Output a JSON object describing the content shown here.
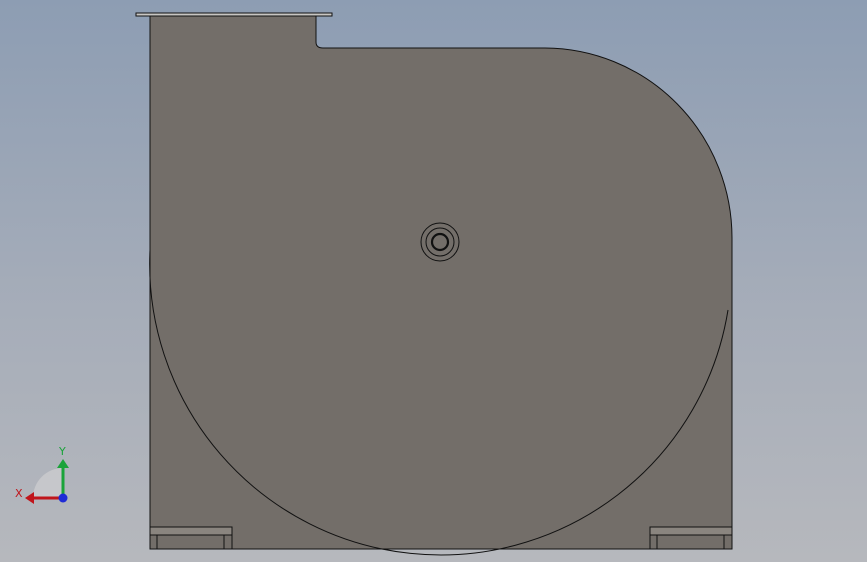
{
  "viewport": {
    "background_top": "#8d9db3",
    "background_bottom": "#b6b8bd"
  },
  "model": {
    "body_color": "#736e69",
    "edge_color": "#111111",
    "flange_color": "#c8c6c3",
    "foot_color": "#8a857f"
  },
  "triad": {
    "x_label": "X",
    "y_label": "Y",
    "x_color": "#c0151b",
    "y_color": "#1aa33a",
    "z_color": "#1f2bd6"
  }
}
